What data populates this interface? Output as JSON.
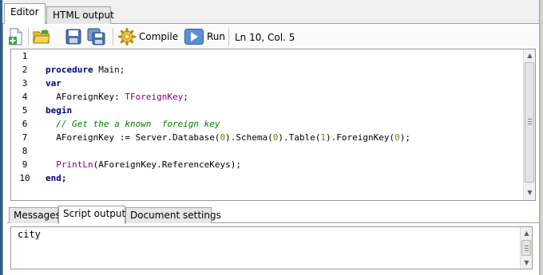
{
  "tabs": {
    "editor": "Editor",
    "html_output": "HTML output"
  },
  "toolbar": {
    "new_icon": "new-file-icon",
    "open_icon": "open-folder-icon",
    "save_icon": "save-icon",
    "save_all_icon": "save-all-icon",
    "compile_label": "Compile",
    "run_label": "Run",
    "status": "Ln 10, Col. 5"
  },
  "editor": {
    "line_numbers": [
      "1",
      "2",
      "3",
      "4",
      "5",
      "6",
      "7",
      "8",
      "9",
      "10"
    ],
    "lines": [
      "",
      "procedure Main;",
      "var",
      "  AForeignKey: TForeignKey;",
      "begin",
      "  // Get the a known  foreign key",
      "  AForeignKey := Server.Database(0).Schema(0).Table(1).ForeignKey(0);",
      "",
      "  PrintLn(AForeignKey.ReferenceKeys);",
      "end;"
    ],
    "tokens": {
      "procedure": "procedure",
      "main": " Main;",
      "var": "var",
      "decl_name": "  AForeignKey: ",
      "decl_type": "TForeignKey",
      "decl_end": ";",
      "begin": "begin",
      "comment": "  // Get the a known  foreign key",
      "assign_a": "  AForeignKey := Server.Database(",
      "n0a": "0",
      "assign_b": ").Schema(",
      "n0b": "0",
      "assign_c": ").Table(",
      "n1": "1",
      "assign_d": ").ForeignKey(",
      "n0c": "0",
      "assign_e": ");",
      "indent": "  ",
      "println": "PrintLn",
      "println_args": "(AForeignKey.ReferenceKeys);",
      "end": "end;"
    }
  },
  "bottom_tabs": {
    "messages": "Messages",
    "script_output": "Script output",
    "document_settings": "Document settings"
  },
  "output": {
    "text": "city"
  }
}
